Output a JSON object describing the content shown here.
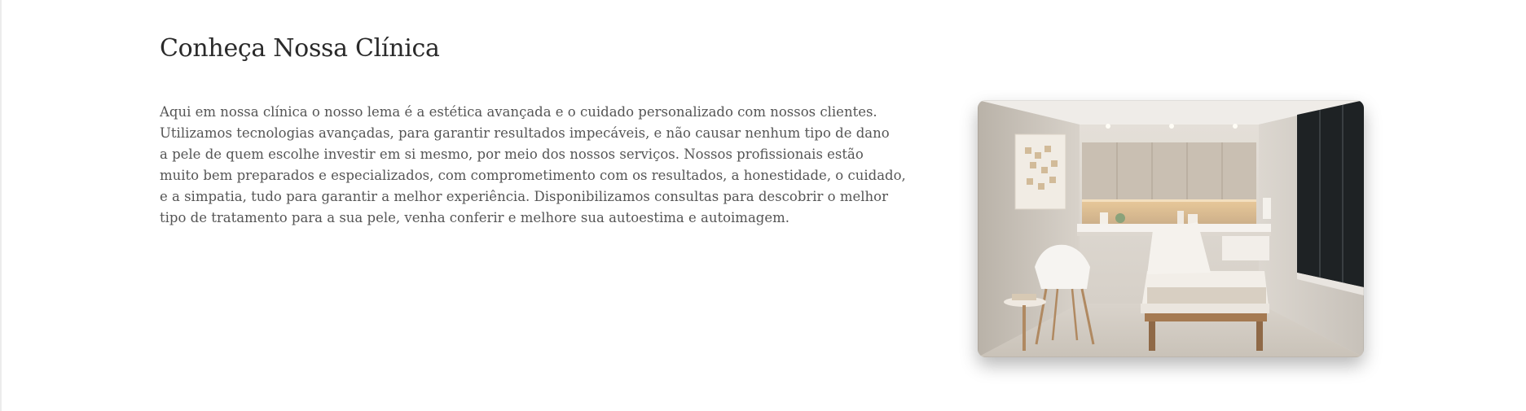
{
  "section": {
    "title": "Conheça Nossa Clínica",
    "paragraph_lines": [
      "Aqui em nossa clínica o nosso lema é a estética avançada e o cuidado personalizado com nossos clientes.",
      "Utilizamos tecnologias avançadas, para garantir resultados impecáveis, e não causar nenhum tipo de dano",
      "a pele de quem escolhe investir em si mesmo, por meio dos nossos serviços. Nossos profissionais estão",
      "muito bem preparados e especializados, com comprometimento com os resultados, a honestidade, o cuidado,",
      "e a simpatia, tudo para garantir a melhor experiência. Disponibilizamos consultas para descobrir o melhor",
      "tipo de tratamento para a sua pele, venha conferir e melhore sua autoestima e autoimagem."
    ]
  },
  "colors": {
    "title": "#2a2a2a",
    "text": "#555555",
    "background": "#ffffff"
  }
}
